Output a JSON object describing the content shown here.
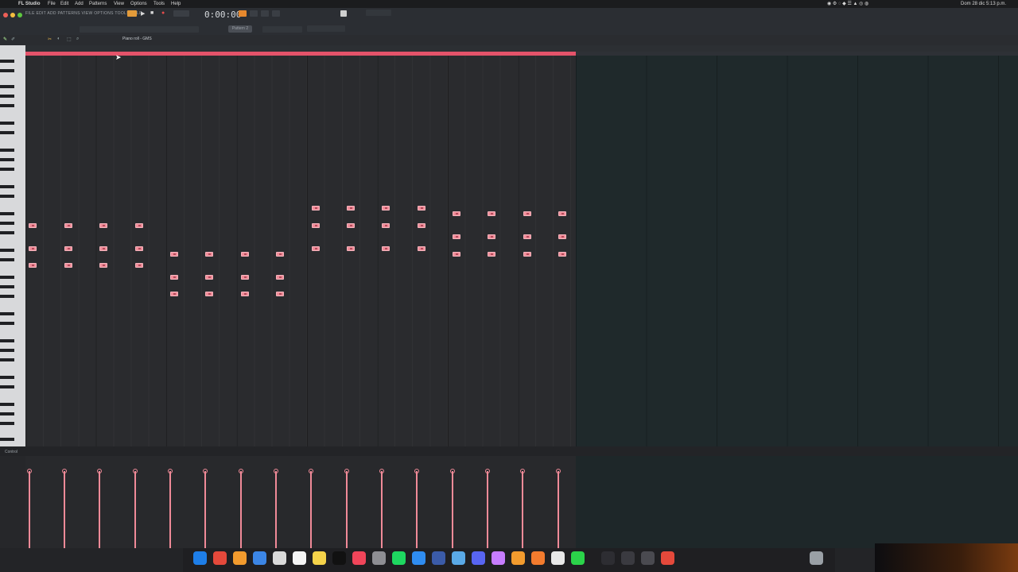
{
  "menubar": {
    "app": "FL Studio",
    "items": [
      "File",
      "Edit",
      "Add",
      "Patterns",
      "View",
      "Options",
      "Tools",
      "Help"
    ],
    "clock": "Dom 28 dic 5:13 p.m."
  },
  "toolbar": {
    "menu_strip": "FILE EDIT ADD PATTERNS VIEW OPTIONS TOOLS HELP",
    "time": "0:00:00",
    "pattern": "Pattern 2",
    "accent": "#e4536a"
  },
  "piano_roll": {
    "title": "Piano roll - GMS",
    "note_color": "#ef8d99",
    "loop_color": "#e4536a"
  },
  "control_lane": {
    "label": "Control"
  },
  "icons": [
    "close-window-icon",
    "minimize-window-icon",
    "zoom-window-icon",
    "play-icon",
    "stop-icon",
    "record-icon",
    "pencil-tool-icon",
    "brush-tool-icon",
    "delete-tool-icon",
    "mute-tool-icon",
    "select-tool-icon",
    "zoom-tool-icon",
    "mouse-cursor-icon"
  ]
}
